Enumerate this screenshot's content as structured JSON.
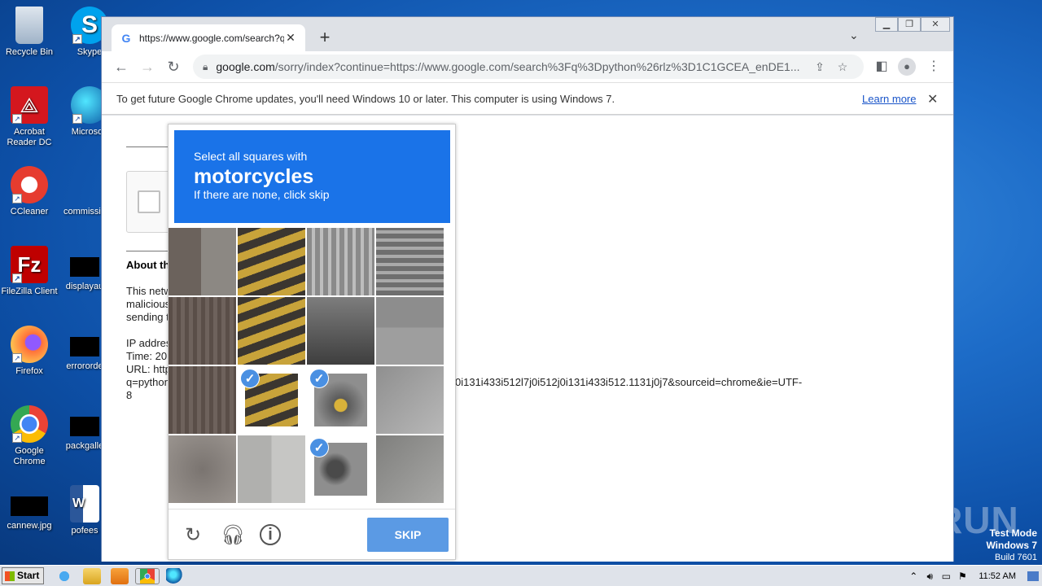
{
  "desktop": {
    "icons": [
      {
        "label": "Recycle Bin"
      },
      {
        "label": "Skype"
      },
      {
        "label": "Acrobat Reader DC"
      },
      {
        "label": "Microsoft"
      },
      {
        "label": "CCleaner"
      },
      {
        "label": "commissio"
      },
      {
        "label": "FileZilla Client"
      },
      {
        "label": "displayau"
      },
      {
        "label": "Firefox"
      },
      {
        "label": "errororde"
      },
      {
        "label": "Google Chrome"
      },
      {
        "label": "packgalle"
      },
      {
        "label": "cannew.jpg"
      },
      {
        "label": "pofees"
      }
    ]
  },
  "browser": {
    "tab_title": "https://www.google.com/search?q=",
    "url_host": "google.com",
    "url_rest": "/sorry/index?continue=https://www.google.com/search%3Fq%3Dpython%26rlz%3D1C1GCEA_enDE1...",
    "infobar_message": "To get future Google Chrome updates, you'll need Windows 10 or later. This computer is using Windows 7.",
    "infobar_link": "Learn more"
  },
  "page": {
    "about_heading": "About th",
    "lines": [
      "This netw",
      "malicious",
      "sending t",
      "IP addres",
      "Time: 20",
      "URL: http",
      "q=python",
      "8"
    ],
    "url_tail": "0i131i433i512l7j0i512j0i131i433i512.1131j0j7&sourceid=chrome&ie=UTF-"
  },
  "captcha": {
    "instruction": "Select all squares with",
    "target": "motorcycles",
    "hint": "If there are none, click skip",
    "skip_label": "SKIP",
    "selected_tiles": [
      9,
      10,
      14
    ]
  },
  "watermark": "ANY RUN",
  "testmode": {
    "line1": "Test Mode",
    "line2": "Windows 7",
    "line3": "Build 7601"
  },
  "taskbar": {
    "start_label": "Start",
    "clock": "11:52 AM"
  }
}
